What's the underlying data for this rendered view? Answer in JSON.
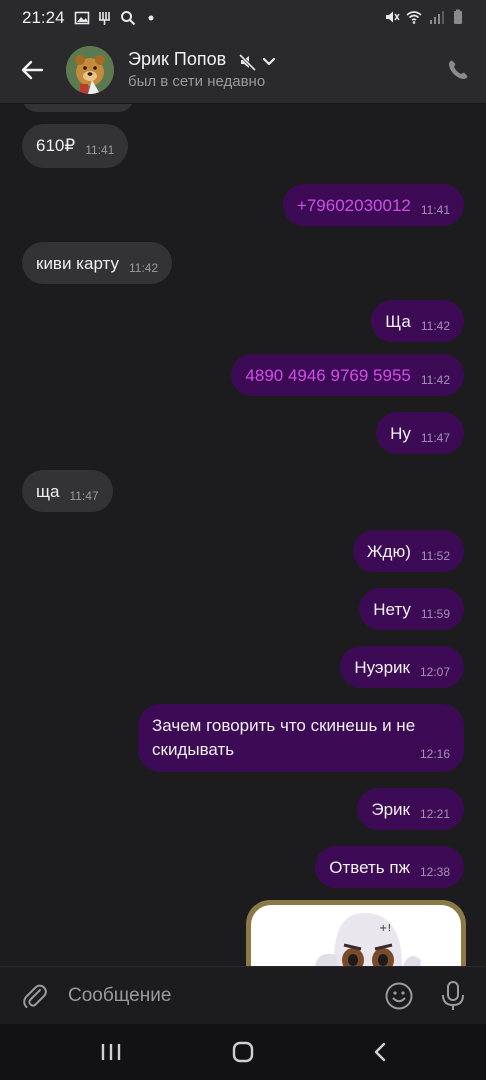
{
  "status_bar": {
    "time": "21:24",
    "left_icons": [
      "image-icon",
      "tuning-fork-icon",
      "search-icon",
      "dot-icon"
    ],
    "right_icons": [
      "mute-icon",
      "wifi-icon",
      "signal-icon",
      "battery-icon"
    ]
  },
  "header": {
    "contact_name": "Эрик Попов",
    "contact_status": "был в сети недавно",
    "muted": true
  },
  "messages": [
    {
      "dir": "in",
      "text": "610₽",
      "time": "11:41"
    },
    {
      "dir": "out",
      "text": "+79602030012",
      "time": "11:41",
      "kind": "phone"
    },
    {
      "dir": "in",
      "text": "киви карту",
      "time": "11:42"
    },
    {
      "dir": "out",
      "text": "Ща",
      "time": "11:42"
    },
    {
      "dir": "out",
      "text": "4890 4946 9769 5955",
      "time": "11:42",
      "kind": "phone"
    },
    {
      "dir": "out",
      "text": "Ну",
      "time": "11:47"
    },
    {
      "dir": "in",
      "text": "ща",
      "time": "11:47"
    },
    {
      "dir": "out",
      "text": "Ждю)",
      "time": "11:52"
    },
    {
      "dir": "out",
      "text": "Нету",
      "time": "11:59"
    },
    {
      "dir": "out",
      "text": "Нуэрик",
      "time": "12:07"
    },
    {
      "dir": "out",
      "text": "Зачем говорить что скинешь и не скидывать",
      "time": "12:16"
    },
    {
      "dir": "out",
      "text": "Эрик",
      "time": "12:21"
    },
    {
      "dir": "out",
      "text": "Ответь пж",
      "time": "12:38"
    }
  ],
  "composer": {
    "placeholder": "Сообщение"
  },
  "colors": {
    "background": "#1c1c1e",
    "bar": "#2a2a2c",
    "incoming_bubble": "#333336",
    "outgoing_bubble": "#3d0b55",
    "link": "#d24ce8",
    "muted_text": "#9a9a9f"
  }
}
